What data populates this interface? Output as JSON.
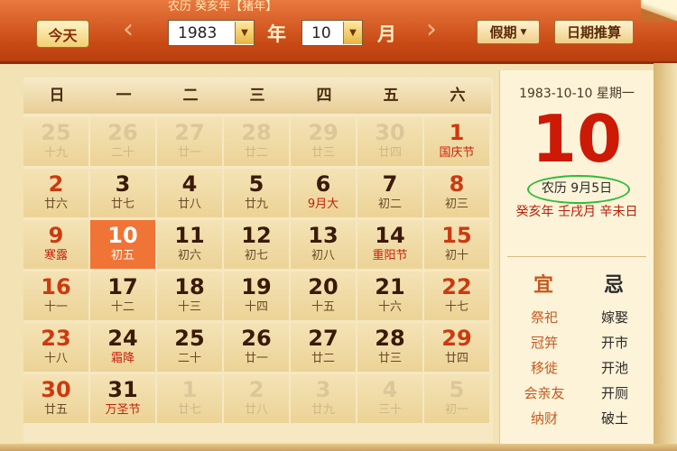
{
  "header": {
    "lunar_title": "农历 癸亥年【猪年】",
    "today_label": "今天",
    "prev_icon": "‹",
    "next_icon": "›",
    "year_value": "1983",
    "year_unit": "年",
    "month_value": "10",
    "month_unit": "月",
    "dropdown_icon": "▼",
    "holiday_label": "假期",
    "calc_label": "日期推算"
  },
  "weekdays": [
    "日",
    "一",
    "二",
    "三",
    "四",
    "五",
    "六"
  ],
  "days": [
    {
      "num": "25",
      "sub": "十九",
      "kind": "other"
    },
    {
      "num": "26",
      "sub": "二十",
      "kind": "other"
    },
    {
      "num": "27",
      "sub": "廿一",
      "kind": "other"
    },
    {
      "num": "28",
      "sub": "廿二",
      "kind": "other"
    },
    {
      "num": "29",
      "sub": "廿三",
      "kind": "other"
    },
    {
      "num": "30",
      "sub": "廿四",
      "kind": "other"
    },
    {
      "num": "1",
      "sub": "国庆节",
      "kind": "weekend holiday"
    },
    {
      "num": "2",
      "sub": "廿六",
      "kind": "weekend"
    },
    {
      "num": "3",
      "sub": "廿七",
      "kind": ""
    },
    {
      "num": "4",
      "sub": "廿八",
      "kind": ""
    },
    {
      "num": "5",
      "sub": "廿九",
      "kind": ""
    },
    {
      "num": "6",
      "sub": "9月大",
      "kind": "holiday"
    },
    {
      "num": "7",
      "sub": "初二",
      "kind": ""
    },
    {
      "num": "8",
      "sub": "初三",
      "kind": "weekend"
    },
    {
      "num": "9",
      "sub": "寒露",
      "kind": "weekend holiday"
    },
    {
      "num": "10",
      "sub": "初五",
      "kind": "today"
    },
    {
      "num": "11",
      "sub": "初六",
      "kind": ""
    },
    {
      "num": "12",
      "sub": "初七",
      "kind": ""
    },
    {
      "num": "13",
      "sub": "初八",
      "kind": ""
    },
    {
      "num": "14",
      "sub": "重阳节",
      "kind": "holiday"
    },
    {
      "num": "15",
      "sub": "初十",
      "kind": "weekend"
    },
    {
      "num": "16",
      "sub": "十一",
      "kind": "weekend"
    },
    {
      "num": "17",
      "sub": "十二",
      "kind": ""
    },
    {
      "num": "18",
      "sub": "十三",
      "kind": ""
    },
    {
      "num": "19",
      "sub": "十四",
      "kind": ""
    },
    {
      "num": "20",
      "sub": "十五",
      "kind": ""
    },
    {
      "num": "21",
      "sub": "十六",
      "kind": ""
    },
    {
      "num": "22",
      "sub": "十七",
      "kind": "weekend"
    },
    {
      "num": "23",
      "sub": "十八",
      "kind": "weekend"
    },
    {
      "num": "24",
      "sub": "霜降",
      "kind": "holiday"
    },
    {
      "num": "25",
      "sub": "二十",
      "kind": ""
    },
    {
      "num": "26",
      "sub": "廿一",
      "kind": ""
    },
    {
      "num": "27",
      "sub": "廿二",
      "kind": ""
    },
    {
      "num": "28",
      "sub": "廿三",
      "kind": ""
    },
    {
      "num": "29",
      "sub": "廿四",
      "kind": "weekend"
    },
    {
      "num": "30",
      "sub": "廿五",
      "kind": "weekend"
    },
    {
      "num": "31",
      "sub": "万圣节",
      "kind": "holiday"
    },
    {
      "num": "1",
      "sub": "廿七",
      "kind": "other"
    },
    {
      "num": "2",
      "sub": "廿八",
      "kind": "other"
    },
    {
      "num": "3",
      "sub": "廿九",
      "kind": "other"
    },
    {
      "num": "4",
      "sub": "三十",
      "kind": "other"
    },
    {
      "num": "5",
      "sub": "初一",
      "kind": "other"
    }
  ],
  "panel": {
    "date_line": "1983-10-10 星期一",
    "big_day": "10",
    "lunar_date": "农历 9月5日",
    "ganzhi": "癸亥年 壬戌月 辛未日",
    "yi_title": "宜",
    "ji_title": "忌",
    "yi_items": [
      "祭祀",
      "冠笄",
      "移徙",
      "会亲友",
      "纳财"
    ],
    "ji_items": [
      "嫁娶",
      "开市",
      "开池",
      "开厕",
      "破土"
    ]
  },
  "colors": {
    "header": "#c94a15",
    "today_cell": "#f07436",
    "weekend_red": "#cc3a10",
    "big_day_red": "#cc1a06",
    "oval_green": "#2dbb3a"
  }
}
